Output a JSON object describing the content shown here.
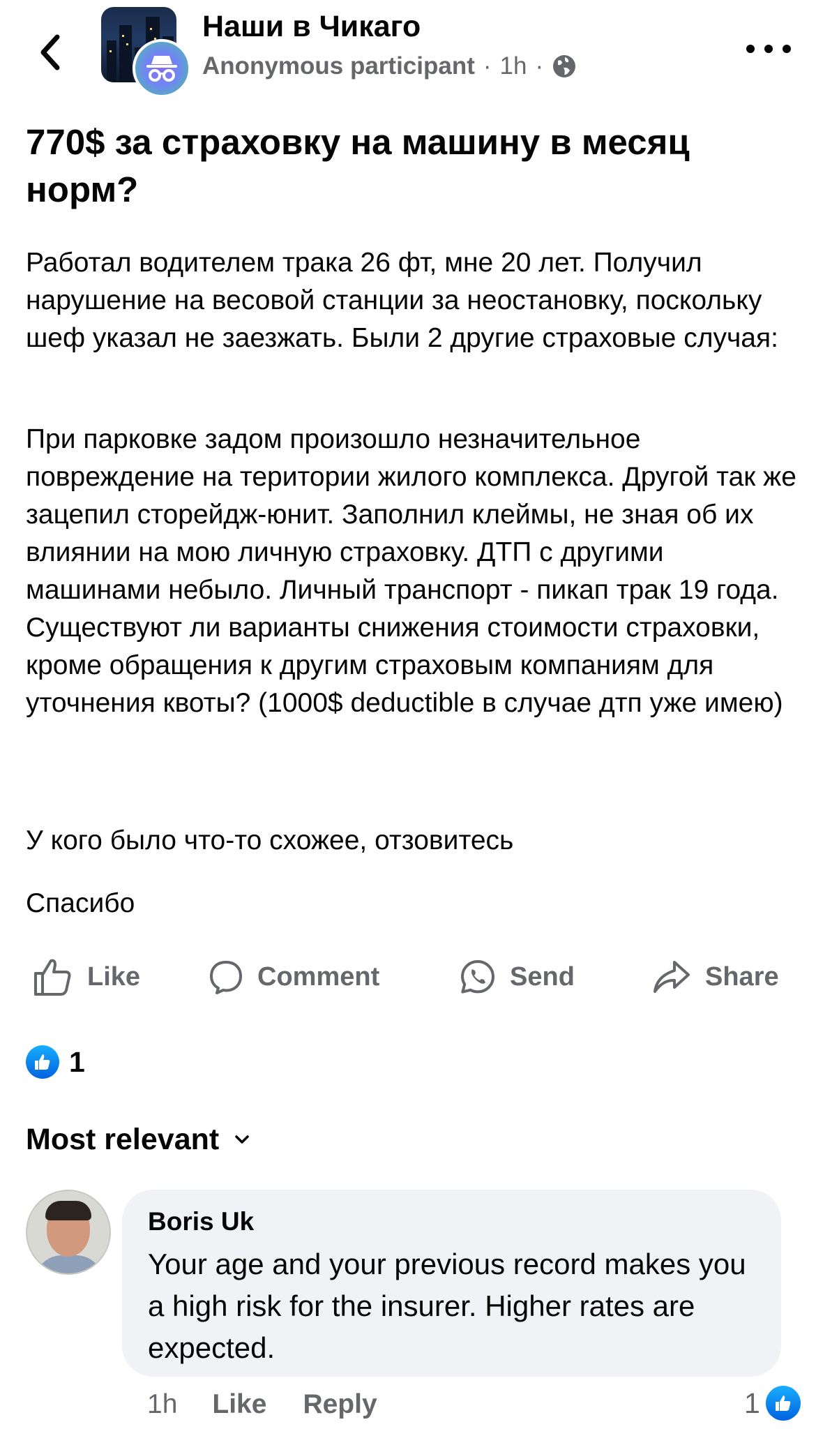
{
  "header": {
    "group_name": "Наши в Чикаго",
    "author": "Anonymous participant",
    "time": "1h",
    "icons": {
      "back": "chevron-left-icon",
      "anon": "incognito-icon",
      "audience": "globe-icon",
      "more": "more-horizontal-icon"
    }
  },
  "post": {
    "title": "770$ за страховку на машину в месяц норм?",
    "paragraphs": [
      "Работал водителем трака 26 фт, мне 20 лет. Получил нарушение на весовой станции за неостановку, поскольку шеф указал не заезжать. Были 2 другие страховые случая:",
      "При парковке задом произошло незначительное повреждение на територии жилого комплекса. Другой так же зацепил сторейдж-юнит. Заполнил клеймы, не зная об их влиянии на мою личную страховку. ДТП с другими машинами небыло. Личный транспорт - пикап трак 19 года. Существуют ли варианты снижения стоимости страховки, кроме обращения к другим страховым компаниям для уточнения квоты? (1000$ deductible в случае дтп уже имею)",
      "У кого было что-то схожее, отзовитесь",
      "Спасибо"
    ]
  },
  "actions": {
    "like": "Like",
    "comment": "Comment",
    "send": "Send",
    "share": "Share"
  },
  "reactions": {
    "count": "1",
    "type": "like"
  },
  "comments_sort": {
    "label": "Most relevant"
  },
  "comment": {
    "author": "Boris Uk",
    "text": "Your age and your previous record makes you a high risk for the insurer. Higher rates are expected.",
    "time": "1h",
    "like_label": "Like",
    "reply_label": "Reply",
    "reaction_count": "1"
  },
  "colors": {
    "accent_blue": "#0866ff",
    "secondary_text": "#65676b",
    "bubble_bg": "#f0f2f5"
  }
}
